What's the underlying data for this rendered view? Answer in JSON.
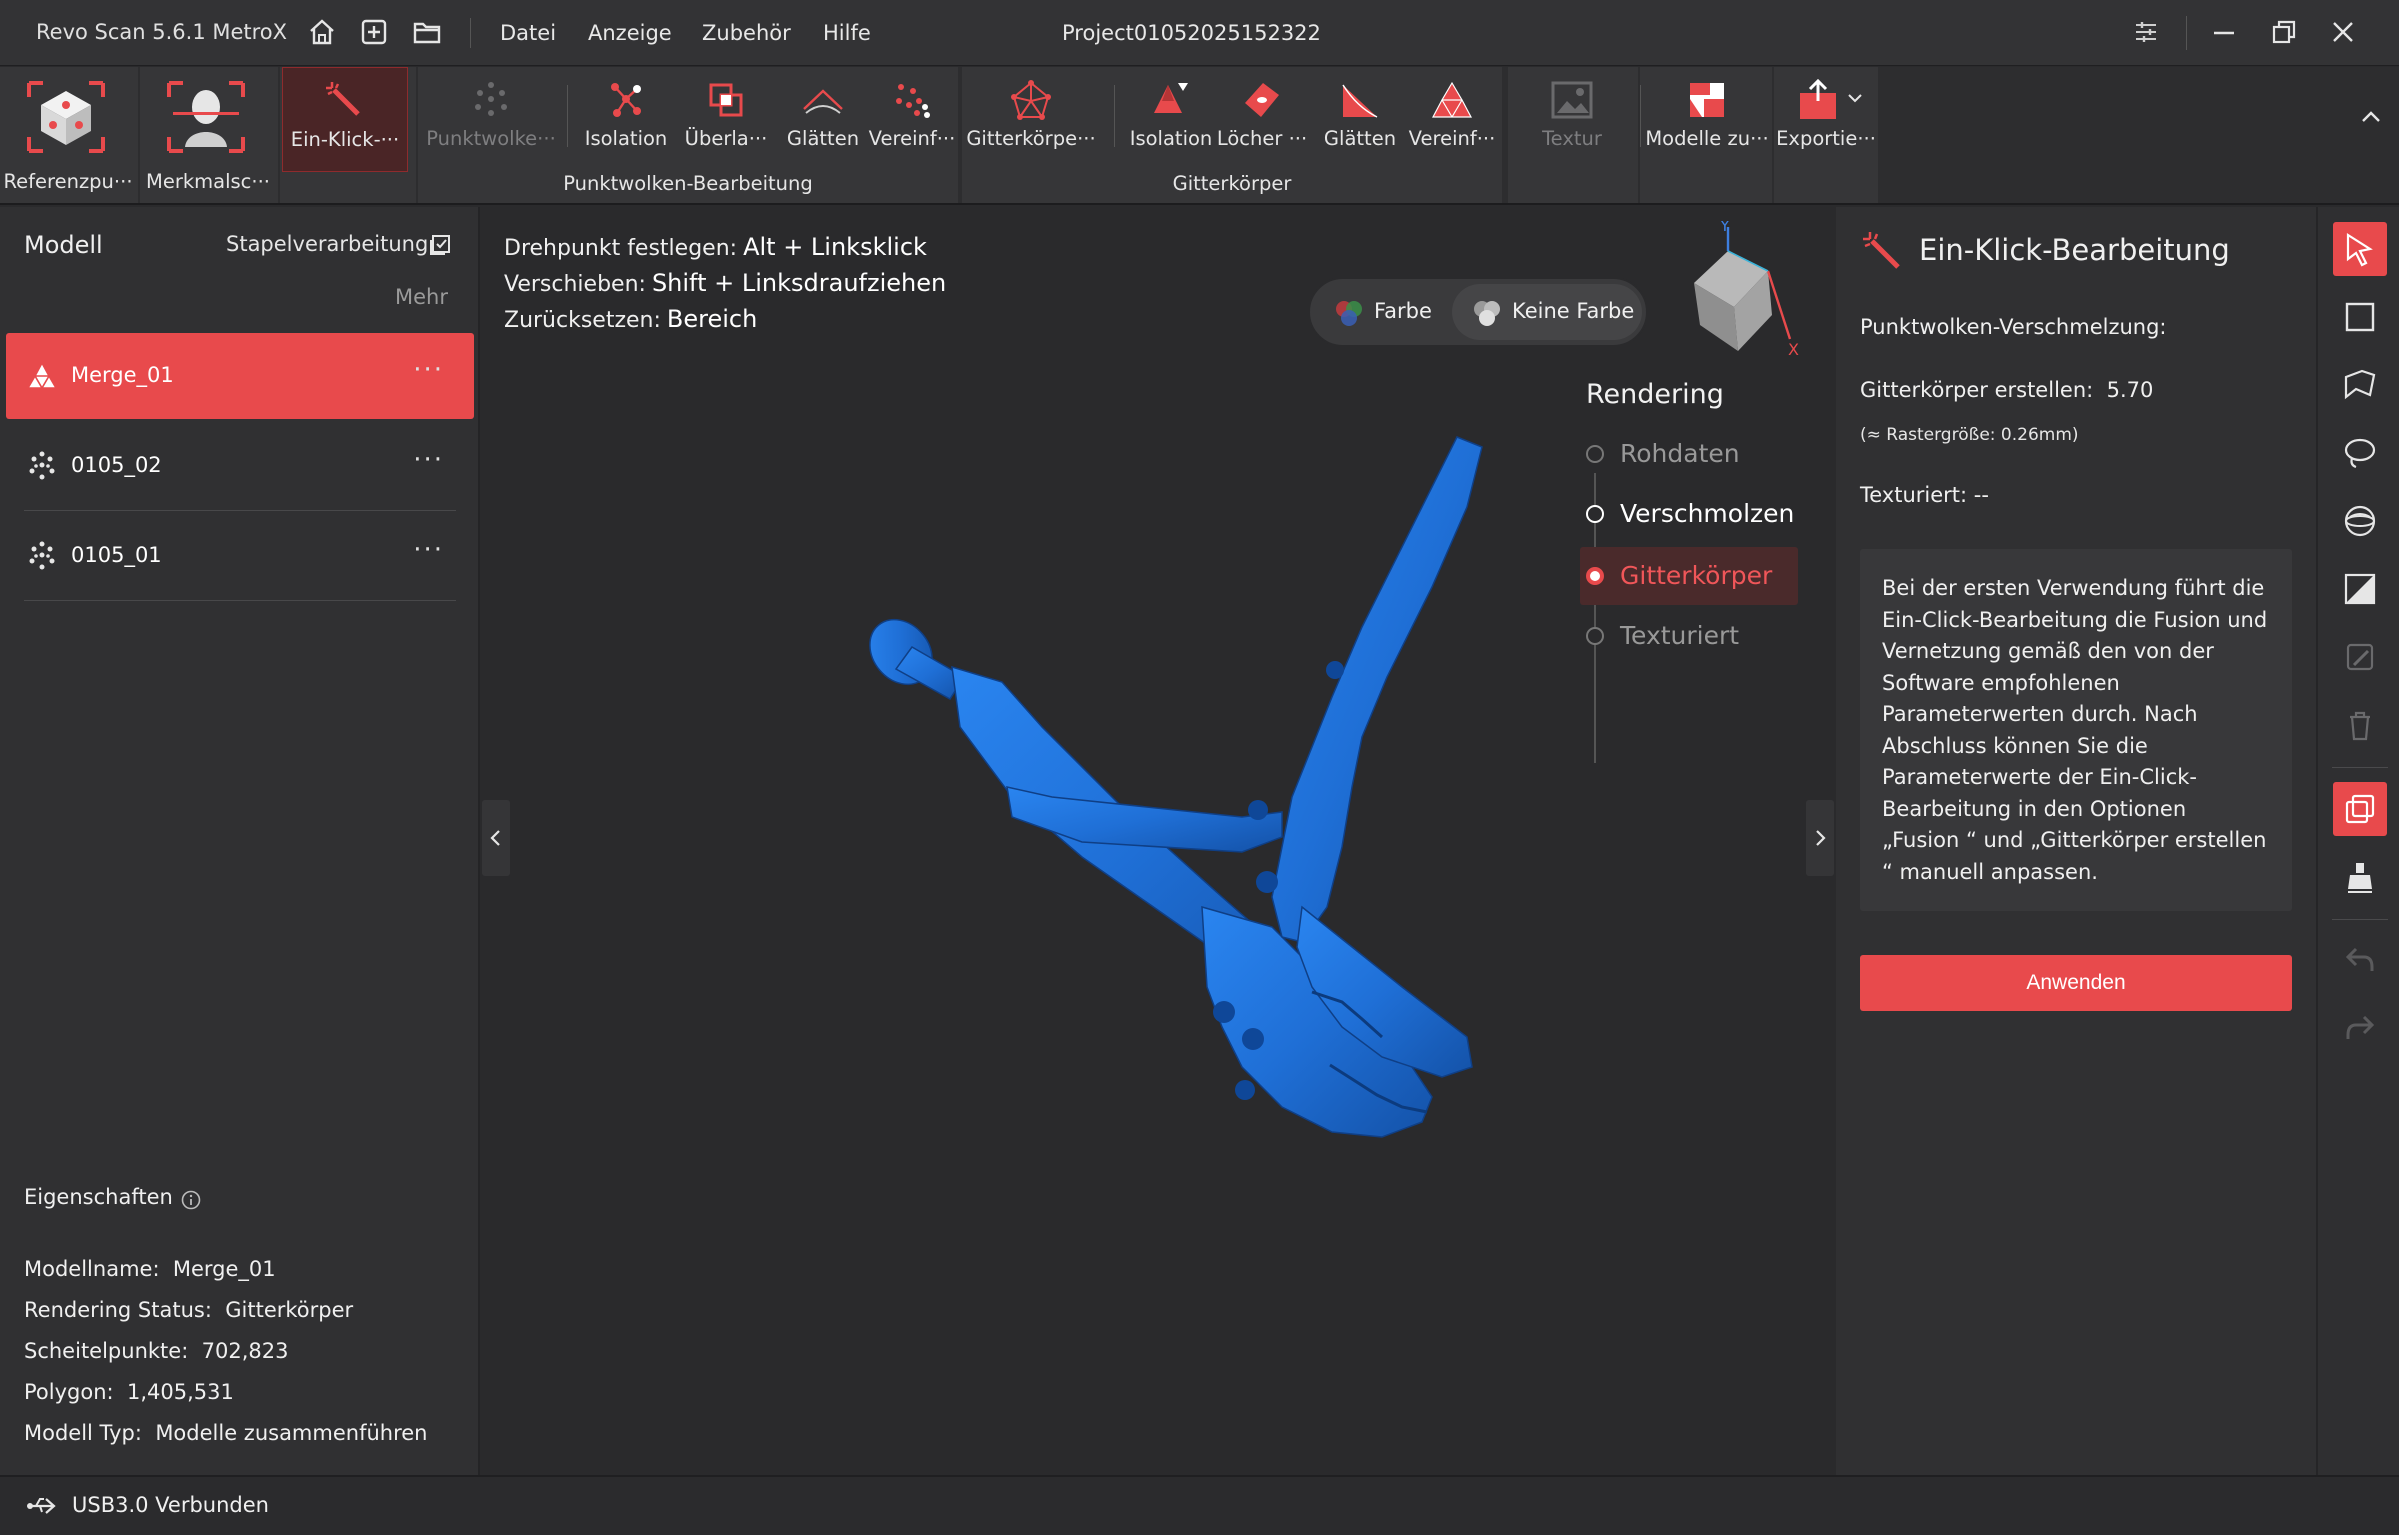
{
  "titlebar": {
    "app_name": "Revo Scan 5.6.1 MetroX",
    "menu": [
      "Datei",
      "Anzeige",
      "Zubehör",
      "Hilfe"
    ],
    "project": "Project01052025152322"
  },
  "ribbon": {
    "tools_left": [
      {
        "label": "Referenzpu···",
        "icon": "reference-point-icon"
      },
      {
        "label": "Merkmalsc···",
        "icon": "feature-scan-icon"
      },
      {
        "label": "Ein-Klick-···",
        "icon": "magic-wand-icon",
        "active": true
      }
    ],
    "pointcloud_group": {
      "name": "Punktwolken-Bearbeitung",
      "items": [
        {
          "label": "Punktwolke···",
          "icon": "pointcloud-icon",
          "disabled": true
        },
        {
          "label": "Isolation",
          "icon": "isolation-icon"
        },
        {
          "label": "Überla···",
          "icon": "overlap-icon"
        },
        {
          "label": "Glätten",
          "icon": "smooth-icon"
        },
        {
          "label": "Vereinf···",
          "icon": "simplify-icon"
        }
      ]
    },
    "mesh_group": {
      "name": "Gitterkörper",
      "items": [
        {
          "label": "Gitterkörpe···",
          "icon": "mesh-icon"
        },
        {
          "label": "Isolation",
          "icon": "mesh-isolation-icon"
        },
        {
          "label": "Löcher ···",
          "icon": "fill-holes-icon"
        },
        {
          "label": "Glätten",
          "icon": "mesh-smooth-icon"
        },
        {
          "label": "Vereinf···",
          "icon": "mesh-simplify-icon"
        }
      ]
    },
    "texture": {
      "label": "Textur",
      "icon": "texture-icon",
      "disabled": true
    },
    "merge": {
      "label": "Modelle zu···",
      "icon": "merge-models-icon"
    },
    "export": {
      "label": "Exportie···",
      "icon": "export-icon"
    }
  },
  "left_panel": {
    "title": "Modell",
    "batch_label": "Stapelverarbeitung",
    "more_label": "Mehr",
    "models": [
      {
        "name": "Merge_01",
        "icon": "mesh-model-icon",
        "selected": true
      },
      {
        "name": "0105_02",
        "icon": "pointcloud-model-icon"
      },
      {
        "name": "0105_01",
        "icon": "pointcloud-model-icon"
      }
    ],
    "row_menu": "···",
    "properties": {
      "title": "Eigenschaften",
      "lines": [
        {
          "key": "Modellname:",
          "value": "Merge_01"
        },
        {
          "key": "Rendering Status:",
          "value": "Gitterkörper"
        },
        {
          "key": "Scheitelpunkte:",
          "value": "702,823"
        },
        {
          "key": "Polygon:",
          "value": "1,405,531"
        },
        {
          "key": "Modell Typ:",
          "value": "Modelle zusammenführen"
        }
      ]
    }
  },
  "viewport": {
    "hints": [
      {
        "label": "Drehpunkt festlegen:",
        "keys": "Alt + Linksklick"
      },
      {
        "label": "Verschieben:",
        "keys": "Shift + Linksdraufziehen"
      },
      {
        "label": "Zurücksetzen:",
        "keys": "Bereich"
      }
    ],
    "color_toggle": {
      "color": "Farbe",
      "no_color": "Keine Farbe",
      "selected": "no_color"
    },
    "view_cube": {
      "axis_y": "Y",
      "axis_x": "X"
    },
    "rendering": {
      "title": "Rendering",
      "options": [
        {
          "label": "Rohdaten",
          "state": "disabled"
        },
        {
          "label": "Verschmolzen",
          "state": "available"
        },
        {
          "label": "Gitterkörper",
          "state": "selected"
        },
        {
          "label": "Texturiert",
          "state": "disabled"
        }
      ]
    },
    "model_color": "#1f6fd6"
  },
  "right_panel": {
    "title": "Ein-Klick-Bearbeitung",
    "pointcloud_fusion": "Punktwolken-Verschmelzung:",
    "mesh_create_label": "Gitterkörper erstellen:",
    "mesh_create_value": "5.70",
    "grid_size": "(≈ Rastergröße: 0.26mm)",
    "textured": "Texturiert: --",
    "note": "Bei der ersten Verwendung führt die Ein-Click-Bearbeitung die Fusion und Vernetzung gemäß den von der Software empfohlenen Parameterwerten durch. Nach Abschluss können Sie die Parameterwerte der Ein-Click-Bearbeitung in den Optionen „Fusion “ und „Gitterkörper erstellen “ manuell anpassen.",
    "apply_button": "Anwenden"
  },
  "status_bar": {
    "text": "USB3.0 Verbunden"
  },
  "colors": {
    "accent": "#e84a4c",
    "panel": "#303032",
    "viewport": "#2a2a2c",
    "model": "#1f6fd6"
  }
}
